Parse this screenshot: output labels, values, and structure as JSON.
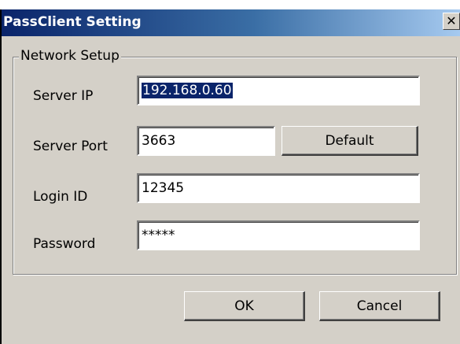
{
  "window": {
    "title": "PassClient Setting"
  },
  "group": {
    "legend": "Network Setup"
  },
  "fields": {
    "server_ip": {
      "label": "Server IP",
      "value": "192.168.0.60"
    },
    "server_port": {
      "label": "Server Port",
      "value": "3663"
    },
    "login_id": {
      "label": "Login ID",
      "value": "12345"
    },
    "password": {
      "label": "Password",
      "value": "*****"
    }
  },
  "buttons": {
    "default": "Default",
    "ok": "OK",
    "cancel": "Cancel"
  },
  "icons": {
    "close": "close-icon"
  },
  "colors": {
    "title_start": "#0a246a",
    "title_end": "#a6caf0",
    "face": "#d4d0c8",
    "selection": "#0a246a"
  }
}
